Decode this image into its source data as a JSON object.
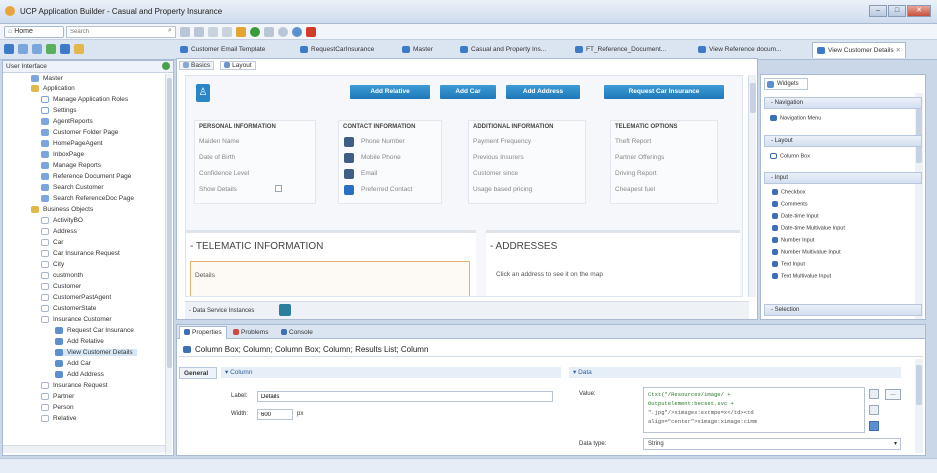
{
  "window": {
    "title": "UCP Application Builder - Casual and Property Insurance"
  },
  "toolbar": {
    "home_label": "Home",
    "search_placeholder": "Search"
  },
  "editor_tabs": [
    {
      "label": "Customer Email Template"
    },
    {
      "label": "RequestCarInsurance"
    },
    {
      "label": "Master"
    },
    {
      "label": "Casual and Property Ins..."
    },
    {
      "label": "FT_Reference_Document..."
    },
    {
      "label": "View Reference docum..."
    },
    {
      "label": "View Customer Details"
    }
  ],
  "sidebar": {
    "title": "User Interface",
    "items": [
      {
        "label": "Master"
      },
      {
        "label": "Application"
      },
      {
        "label": "Manage Application Roles"
      },
      {
        "label": "Settings"
      },
      {
        "label": "AgentReports"
      },
      {
        "label": "Customer Folder Page"
      },
      {
        "label": "HomePageAgent"
      },
      {
        "label": "InboxPage"
      },
      {
        "label": "Manage Reports"
      },
      {
        "label": "Reference Document Page"
      },
      {
        "label": "Search Customer"
      },
      {
        "label": "Search ReferenceDoc Page"
      },
      {
        "label": "Business Objects"
      },
      {
        "label": "ActivityBO"
      },
      {
        "label": "Address"
      },
      {
        "label": "Car"
      },
      {
        "label": "Car Insurance Request"
      },
      {
        "label": "City"
      },
      {
        "label": "custmonth"
      },
      {
        "label": "Customer"
      },
      {
        "label": "CustomerPastAgent"
      },
      {
        "label": "CustomerState"
      },
      {
        "label": "Insurance Customer"
      },
      {
        "label": "Request Car Insurance"
      },
      {
        "label": "Add Relative"
      },
      {
        "label": "View Customer Details"
      },
      {
        "label": "Add Car"
      },
      {
        "label": "Add Address"
      },
      {
        "label": "Insurance Request"
      },
      {
        "label": "Partner"
      },
      {
        "label": "Person"
      },
      {
        "label": "Relative"
      }
    ]
  },
  "layout_tabs": {
    "basics": "Basics",
    "layout": "Layout"
  },
  "actions": {
    "add_relative": "Add Relative",
    "add_car": "Add Car",
    "add_address": "Add Address",
    "request_car_insurance": "Request Car Insurance"
  },
  "groups": {
    "personal": {
      "title": "PERSONAL INFORMATION",
      "items": [
        "Maiden Name",
        "Date of Birth",
        "Confidence Level",
        "Show Details"
      ]
    },
    "contact": {
      "title": "CONTACT INFORMATION",
      "items": [
        "Phone Number",
        "Mobile Phone",
        "Email",
        "Preferred Contact"
      ]
    },
    "additional": {
      "title": "ADDITIONAL INFORMATION",
      "items": [
        "Payment Frequency",
        "Previous Insurers",
        "Customer since",
        "Usage based pricing"
      ]
    },
    "telematic": {
      "title": "TELEMATIC OPTIONS",
      "items": [
        "Theft Report",
        "Partner Offerings",
        "Driving Report",
        "Cheapest fuel"
      ]
    }
  },
  "sections": {
    "telematic_info": "- TELEMATIC INFORMATION",
    "details": "Details",
    "addresses": "- ADDRESSES",
    "address_hint": "Click an address to see it on the map"
  },
  "data_service": {
    "label": "- Data Service Instances"
  },
  "palette": {
    "tab": "Widgets",
    "categories": {
      "navigation": "- Navigation",
      "layout": "- Layout",
      "input": "- Input",
      "selection": "- Selection"
    },
    "navigation_items": [
      "Navigation Menu"
    ],
    "layout_items": [
      "Column Box"
    ],
    "input_items": [
      "Checkbox",
      "Comments",
      "Date-time Input",
      "Date-time Multivalue Input",
      "Number Input",
      "Number Multivalue Input",
      "Text Input",
      "Text Multivalue Input"
    ]
  },
  "bottom_tabs": {
    "properties": "Properties",
    "problems": "Problems",
    "console": "Console"
  },
  "properties": {
    "breadcrumb": "Column Box; Column; Column Box; Column; Results List; Column",
    "general_tab": "General",
    "column_section": "▾ Column",
    "data_section": "▾ Data",
    "label_caption": "Label:",
    "label_value": "Details",
    "width_caption": "Width:",
    "width_value": "600",
    "width_unit": "px",
    "value_caption": "Value:",
    "value_lines": [
      "Ctxt(\"/Resources/image/ +",
      "Outputelement:becset.svc +",
      "\".jpg\"/>ximagex:extmpe=x</td><td",
      "align=\"center\">ximage:ximage:cimm"
    ],
    "datatype_caption": "Data type:",
    "datatype_value": "String"
  },
  "colors": {
    "accent": "#2a86c8",
    "panel_bg": "#ffffff",
    "frame": "#c9d7e8"
  }
}
